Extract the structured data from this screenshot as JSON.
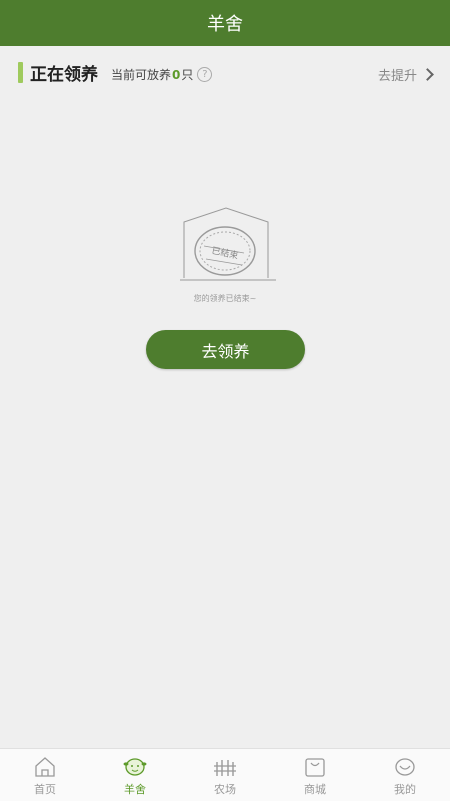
{
  "header": {
    "title": "羊舍"
  },
  "section": {
    "title": "正在领养",
    "sub_prefix": "当前可放养",
    "count": "0",
    "sub_suffix": "只",
    "help_icon": "question-circle-icon",
    "upgrade_label": "去提升"
  },
  "empty_state": {
    "stamp_text": "已结束",
    "message": "您的领养已结束~"
  },
  "adopt_button": {
    "label": "去领养"
  },
  "tabbar": {
    "active_color": "#5d9a2a",
    "items": [
      {
        "label": "首页",
        "icon": "home-icon"
      },
      {
        "label": "羊舍",
        "icon": "sheep-icon",
        "active": true
      },
      {
        "label": "农场",
        "icon": "fence-icon"
      },
      {
        "label": "商城",
        "icon": "shopping-bag-icon"
      },
      {
        "label": "我的",
        "icon": "profile-icon"
      }
    ]
  },
  "colors": {
    "brand": "#4e7d2e",
    "accent": "#9fca5d"
  }
}
